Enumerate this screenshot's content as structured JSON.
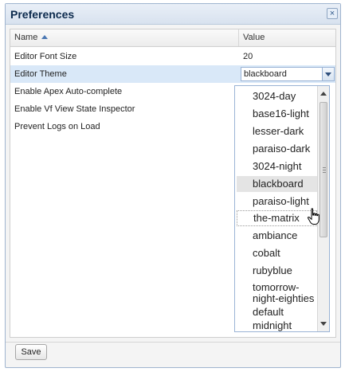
{
  "dialog": {
    "title": "Preferences",
    "close_glyph": "×",
    "icons": [
      "close-icon",
      "sort-asc-icon",
      "chevron-down-icon",
      "scroll-up-icon",
      "scroll-down-icon",
      "hand-cursor-icon"
    ]
  },
  "grid": {
    "columns": {
      "name": "Name",
      "value": "Value"
    },
    "rows": [
      {
        "name": "Editor Font Size",
        "value": "20"
      },
      {
        "name": "Editor Theme",
        "value": "blackboard"
      },
      {
        "name": "Enable Apex Auto-complete",
        "value": ""
      },
      {
        "name": "Enable Vf View State Inspector",
        "value": ""
      },
      {
        "name": "Prevent Logs on Load",
        "value": ""
      }
    ]
  },
  "theme_dropdown": {
    "selected": "blackboard",
    "hovered": "the-matrix",
    "options": [
      {
        "label": "3024-day"
      },
      {
        "label": "base16-light"
      },
      {
        "label": "lesser-dark"
      },
      {
        "label": "paraiso-dark"
      },
      {
        "label": "3024-night"
      },
      {
        "label": "blackboard"
      },
      {
        "label": "paraiso-light"
      },
      {
        "label": "the-matrix"
      },
      {
        "label": "ambiance"
      },
      {
        "label": "cobalt"
      },
      {
        "label": "rubyblue"
      },
      {
        "label": "tomorrow-night-eighties",
        "lines": [
          "tomorrow-",
          "night-eighties"
        ]
      },
      {
        "label": "default"
      },
      {
        "label": "midnight"
      }
    ]
  },
  "footer": {
    "save_label": "Save"
  },
  "colors": {
    "title": "#0c2a4d",
    "selected_row": "#d9e8f8",
    "border": "#9ab3d5"
  }
}
